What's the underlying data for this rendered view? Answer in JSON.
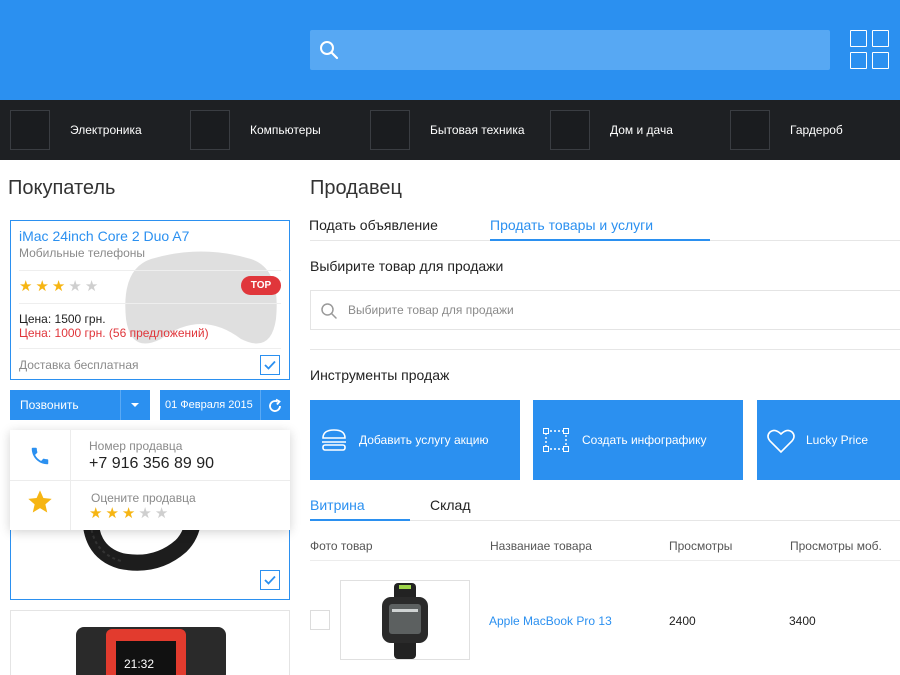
{
  "header": {
    "search": {
      "placeholder": "",
      "value": "",
      "icon": "search-icon"
    },
    "apps_icon": "grid-icon",
    "colors": {
      "accent": "#2b90f0",
      "nav_bg": "#1e2023",
      "danger": "#e0363b",
      "star": "#f6b513"
    }
  },
  "nav": {
    "items": [
      {
        "label": "Электроника"
      },
      {
        "label": "Компьютеры"
      },
      {
        "label": "Бытовая техника"
      },
      {
        "label": "Дом и дача"
      },
      {
        "label": "Гардероб"
      }
    ]
  },
  "buyer": {
    "heading": "Покупатель",
    "product": {
      "title": "iMac 24inch Core 2 Duo A7",
      "category": "Мобильные телефоны",
      "rating": 3,
      "rating_max": 5,
      "badge": "TOP",
      "price": "Цена: 1500 грн.",
      "price_offers": "Цена: 1000 грн. (56 предложений)",
      "delivery": "Доставка бесплатная",
      "checked": true
    },
    "call_button": "Позвонить",
    "date_button": "01 Февраля 2015",
    "popup": {
      "phone_label": "Номер продавца",
      "phone_value": "+7 916 356 89 90",
      "rate_label": "Оцените продавца",
      "rating": 3,
      "rating_max": 5
    },
    "product2": {
      "checked": true
    },
    "product3": {
      "screen_time": "21:32"
    }
  },
  "seller": {
    "heading": "Продавец",
    "tabs": [
      {
        "label": "Подать объявление",
        "active": false
      },
      {
        "label": "Продать товары и услуги",
        "active": true
      }
    ],
    "choose_label": "Выбирите товар для продажи",
    "choose_input": {
      "placeholder": "Выбирите товар для продажи",
      "value": ""
    },
    "tools_label": "Инструменты продаж",
    "tools": [
      {
        "label": "Добавить услугу акцию",
        "icon": "burger-icon"
      },
      {
        "label": "Создать инфографику",
        "icon": "frame-icon"
      },
      {
        "label": "Lucky Price",
        "icon": "heart-icon"
      }
    ],
    "tabs2": [
      {
        "label": "Витрина",
        "active": true
      },
      {
        "label": "Склад",
        "active": false
      }
    ],
    "table": {
      "columns": [
        "Фото товар",
        "Названиае товара",
        "Просмотры",
        "Просмотры моб."
      ],
      "rows": [
        {
          "name": "Apple MacBook Pro 13",
          "views": "2400",
          "mobile_views": "3400"
        }
      ]
    }
  }
}
